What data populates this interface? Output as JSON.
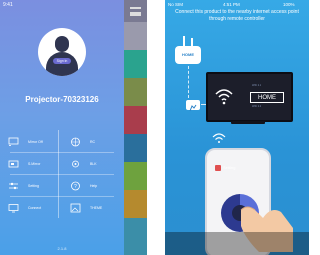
{
  "left_screen": {
    "status_time": "9:41",
    "status_battery": "",
    "avatar_label": "Sign in",
    "device_title": "Projector-70323126",
    "menu": [
      {
        "label": "Mirror Off",
        "icon": "cast-icon"
      },
      {
        "label": "RC",
        "icon": "globe-icon"
      },
      {
        "label": "S.Mirror",
        "icon": "screen-icon"
      },
      {
        "label": "BLK",
        "icon": "settings-icon"
      },
      {
        "label": "Setting",
        "icon": "gear-icon"
      },
      {
        "label": "Help",
        "icon": "question-icon"
      },
      {
        "label": "Connect",
        "icon": "monitor-icon"
      },
      {
        "label": "THEME",
        "icon": "picture-icon"
      }
    ],
    "version": "2.1.8",
    "strip_colors": [
      "#6b6b8a",
      "#2aa38e",
      "#7a8c4a",
      "#a93d4c",
      "#2a6f9c",
      "#6ea23e",
      "#b58a2e",
      "#3b8ea8",
      "#7e4aa0"
    ]
  },
  "right_screen": {
    "status_left": "No SIM",
    "status_time": "4:51 PM",
    "status_right": "100%",
    "instruction": "Connect this product to the nearby internet access point through remote controller",
    "router_label": "HOME",
    "tv_home_label": "HOME",
    "tv_tiny_top": "WiFi 2.1",
    "tv_tiny_bottom": "WiFi 2.2",
    "phone_setting_label": "Setting"
  }
}
